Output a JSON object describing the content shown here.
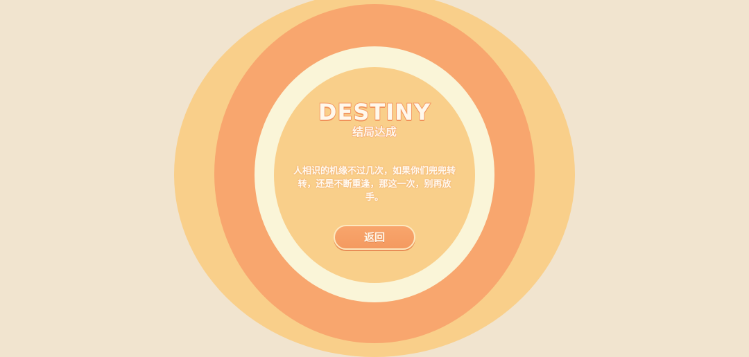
{
  "ending": {
    "title": "DESTINY",
    "subtitle": "结局达成",
    "message": "人相识的机缘不过几次，如果你们兜兜转转，还是不断重逢，那这一次，别再放手。"
  },
  "actions": {
    "back_label": "返回"
  },
  "colors": {
    "background": "#f1e4cf",
    "ring_outer": "#f9cf8a",
    "ring_mid": "#f8a66e",
    "ring_light": "#faf5d8",
    "ring_inner": "#f9cf8a",
    "button": "#f8a66e"
  }
}
